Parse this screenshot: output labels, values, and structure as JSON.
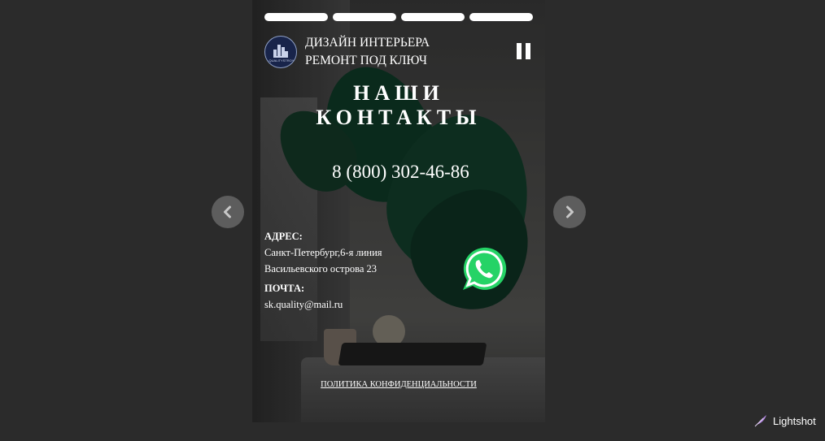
{
  "story": {
    "brand_line1": "ДИЗАЙН ИНТЕРЬЕРА",
    "brand_line2": "РЕМОНТ ПОД КЛЮЧ",
    "logo_text": "QUALITYSTROY",
    "title_line1": "НАШИ",
    "title_line2": "КОНТАКТЫ",
    "phone": "8 (800) 302-46-86",
    "address_label": "АДРЕС:",
    "address_line1": "Санкт-Петербург,6-я линия",
    "address_line2": "Васильевского острова 23",
    "email_label": "ПОЧТА:",
    "email": "sk.quality@mail.ru",
    "policy_link": "ПОЛИТИКА КОНФИДЕНЦИАЛЬНОСТИ",
    "progress_segments": 4
  },
  "icons": {
    "prev": "chevron-left-icon",
    "next": "chevron-right-icon",
    "pause": "pause-icon",
    "whatsapp": "whatsapp-icon",
    "lightshot": "feather-icon"
  },
  "colors": {
    "background": "#2b2b2b",
    "nav_button": "#5d5d5d",
    "whatsapp": "#25d366",
    "logo_bg": "#18244a"
  },
  "overlay": {
    "app_name": "Lightshot"
  }
}
